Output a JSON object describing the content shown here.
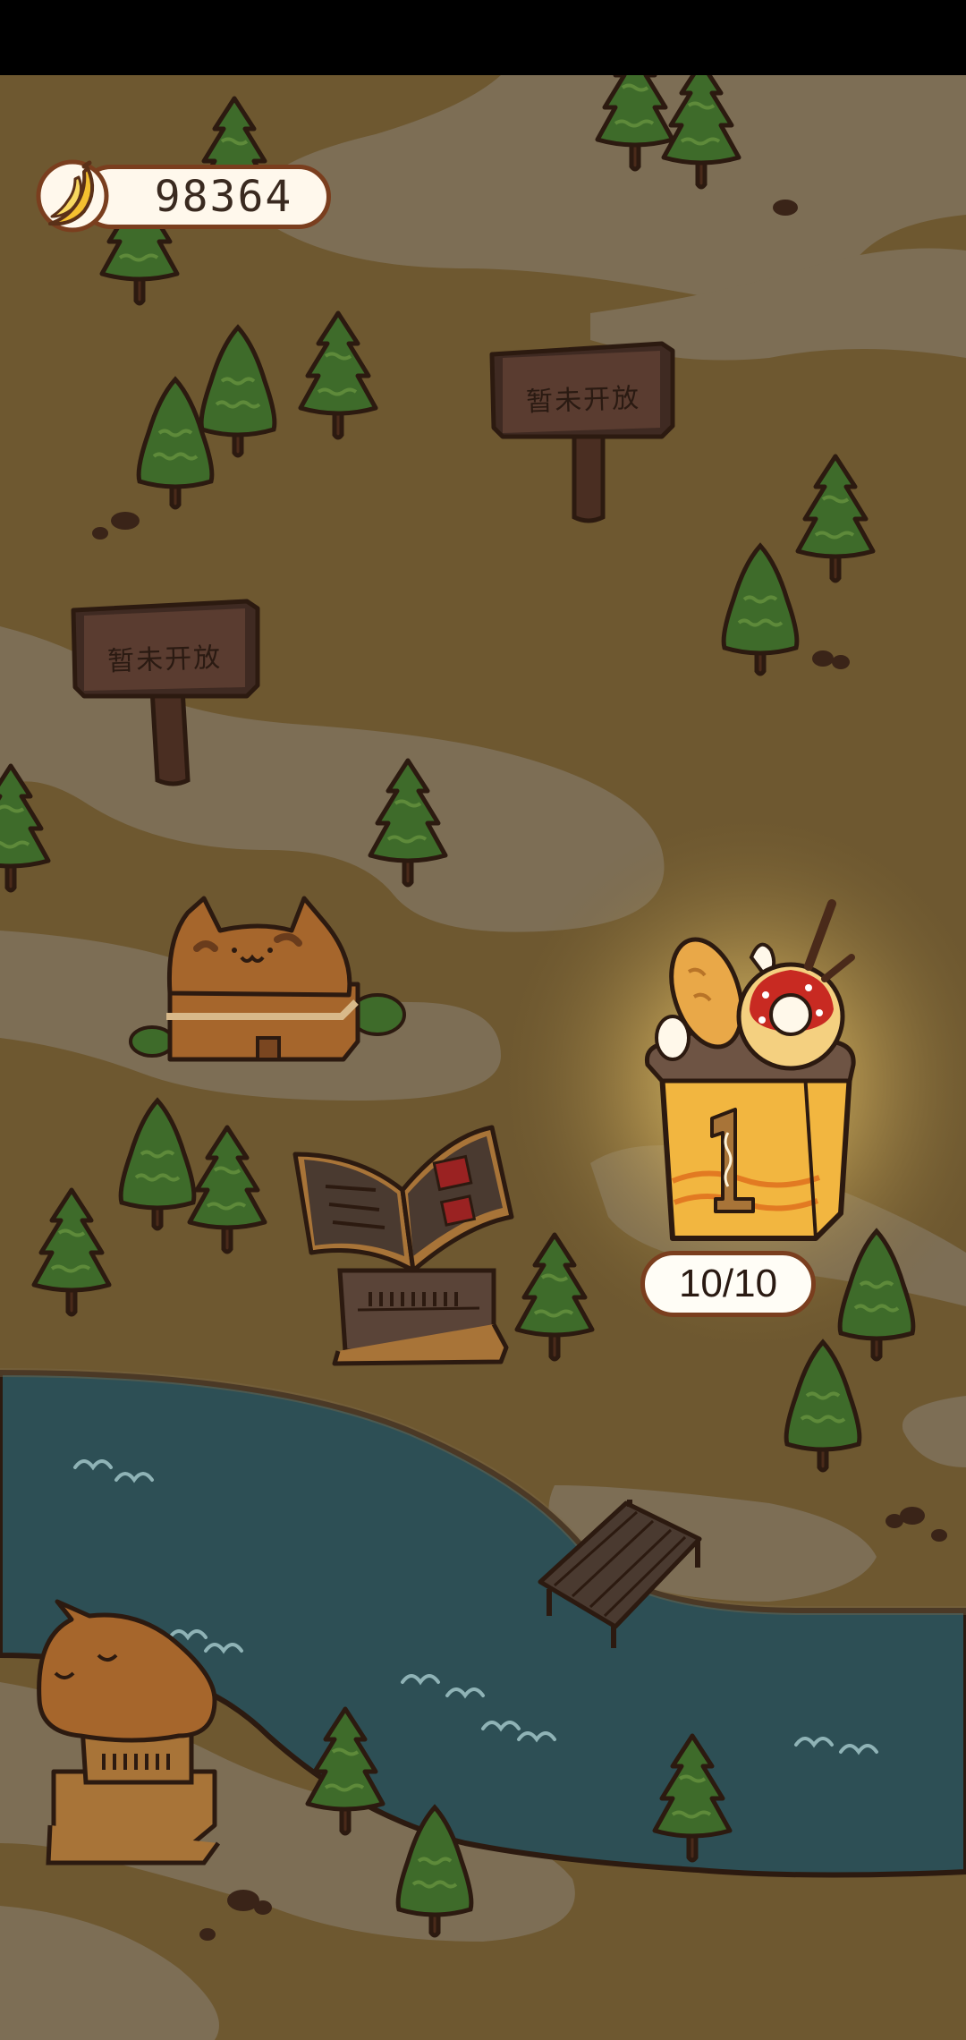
{
  "currency": {
    "value": "98364",
    "icon": "banana-icon"
  },
  "signs": [
    {
      "label": "暂未开放"
    },
    {
      "label": "暂未开放"
    }
  ],
  "level": {
    "number": "1",
    "progress": "10/10"
  },
  "colors": {
    "ground": "#6e5830",
    "path": "#7d6e55",
    "river": "#2d4f55",
    "tree": "#3d6a2a",
    "outline": "#3a2418",
    "glow": "#f3d36a",
    "bucket": "#f2b640"
  }
}
